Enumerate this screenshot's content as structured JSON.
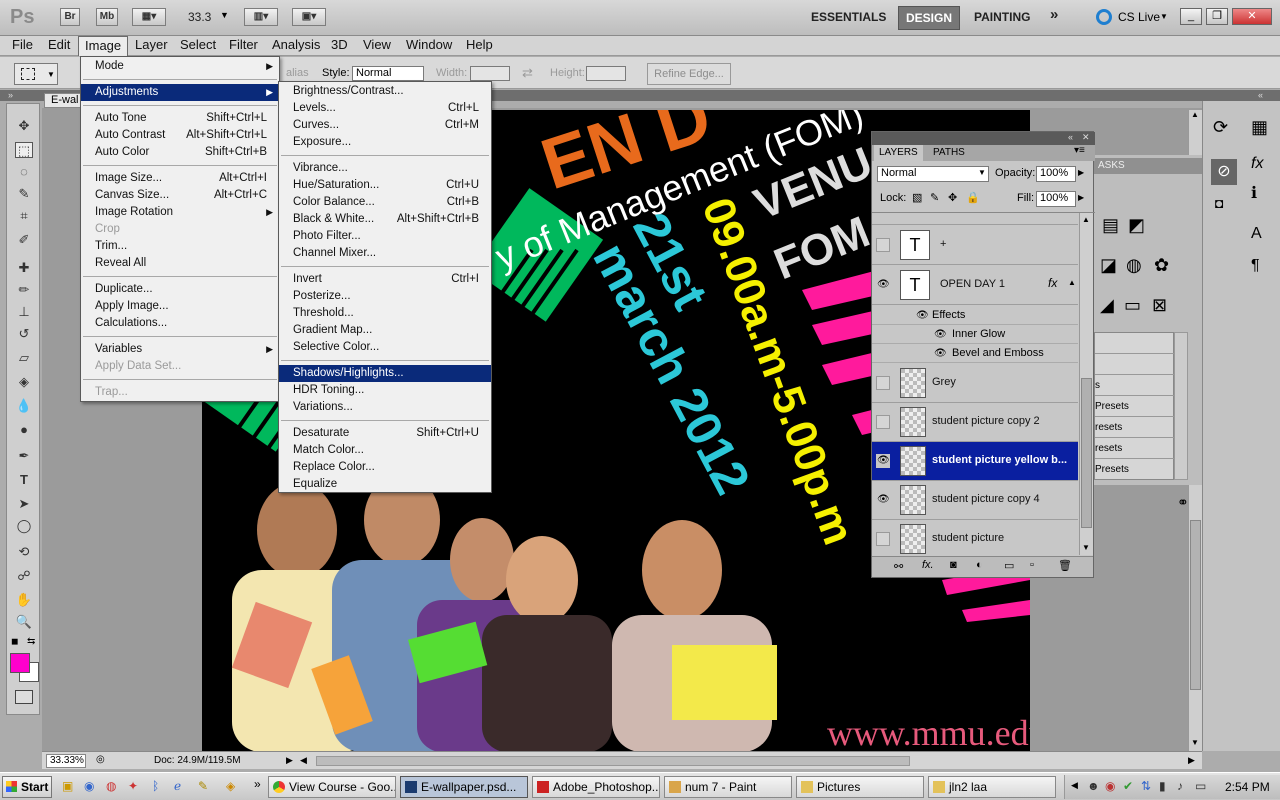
{
  "titlebar": {
    "app_logo": "Ps",
    "bridge_btn": "Br",
    "minibridge_btn": "Mb",
    "zoom_value": "33.3",
    "workspaces": [
      "ESSENTIALS",
      "DESIGN",
      "PAINTING"
    ],
    "more": "»",
    "cs_live": "CS Live",
    "window_controls": [
      "_",
      "❐",
      "✕"
    ]
  },
  "menubar": [
    "File",
    "Edit",
    "Image",
    "Layer",
    "Select",
    "Filter",
    "Analysis",
    "3D",
    "View",
    "Window",
    "Help"
  ],
  "optionsbar": {
    "antialias": "alias",
    "style_label": "Style:",
    "style_value": "Normal",
    "width_label": "Width:",
    "height_label": "Height:",
    "refine_edge": "Refine Edge..."
  },
  "document": {
    "tab_title": "E-wal",
    "status_zoom": "33.33%",
    "status_doc": "Doc: 24.9M/119.5M",
    "art": {
      "line1": "EN D",
      "line2": "y of Management (FOM)",
      "venue": "VENU",
      "fom": "FOM",
      "date": "21st",
      "month": "march 2012",
      "time": "09.00a.m-5.00p.m",
      "url": "www.mmu.edu"
    }
  },
  "image_menu": [
    {
      "label": "Mode",
      "shortcut": "",
      "submenu": true
    },
    {
      "sep": true
    },
    {
      "label": "Adjustments",
      "shortcut": "",
      "submenu": true,
      "highlight": true
    },
    {
      "sep": true
    },
    {
      "label": "Auto Tone",
      "shortcut": "Shift+Ctrl+L"
    },
    {
      "label": "Auto Contrast",
      "shortcut": "Alt+Shift+Ctrl+L"
    },
    {
      "label": "Auto Color",
      "shortcut": "Shift+Ctrl+B"
    },
    {
      "sep": true
    },
    {
      "label": "Image Size...",
      "shortcut": "Alt+Ctrl+I"
    },
    {
      "label": "Canvas Size...",
      "shortcut": "Alt+Ctrl+C"
    },
    {
      "label": "Image Rotation",
      "shortcut": "",
      "submenu": true
    },
    {
      "label": "Crop",
      "shortcut": "",
      "disabled": true
    },
    {
      "label": "Trim...",
      "shortcut": ""
    },
    {
      "label": "Reveal All",
      "shortcut": ""
    },
    {
      "sep": true
    },
    {
      "label": "Duplicate...",
      "shortcut": ""
    },
    {
      "label": "Apply Image...",
      "shortcut": ""
    },
    {
      "label": "Calculations...",
      "shortcut": ""
    },
    {
      "sep": true
    },
    {
      "label": "Variables",
      "shortcut": "",
      "submenu": true
    },
    {
      "label": "Apply Data Set...",
      "shortcut": "",
      "disabled": true
    },
    {
      "sep": true
    },
    {
      "label": "Trap...",
      "shortcut": "",
      "disabled": true
    }
  ],
  "adjustments_menu": [
    {
      "label": "Brightness/Contrast...",
      "shortcut": ""
    },
    {
      "label": "Levels...",
      "shortcut": "Ctrl+L"
    },
    {
      "label": "Curves...",
      "shortcut": "Ctrl+M"
    },
    {
      "label": "Exposure...",
      "shortcut": ""
    },
    {
      "sep": true
    },
    {
      "label": "Vibrance...",
      "shortcut": ""
    },
    {
      "label": "Hue/Saturation...",
      "shortcut": "Ctrl+U"
    },
    {
      "label": "Color Balance...",
      "shortcut": "Ctrl+B"
    },
    {
      "label": "Black & White...",
      "shortcut": "Alt+Shift+Ctrl+B"
    },
    {
      "label": "Photo Filter...",
      "shortcut": ""
    },
    {
      "label": "Channel Mixer...",
      "shortcut": ""
    },
    {
      "sep": true
    },
    {
      "label": "Invert",
      "shortcut": "Ctrl+I"
    },
    {
      "label": "Posterize...",
      "shortcut": ""
    },
    {
      "label": "Threshold...",
      "shortcut": ""
    },
    {
      "label": "Gradient Map...",
      "shortcut": ""
    },
    {
      "label": "Selective Color...",
      "shortcut": ""
    },
    {
      "sep": true
    },
    {
      "label": "Shadows/Highlights...",
      "shortcut": "",
      "highlight": true
    },
    {
      "label": "HDR Toning...",
      "shortcut": ""
    },
    {
      "label": "Variations...",
      "shortcut": ""
    },
    {
      "sep": true
    },
    {
      "label": "Desaturate",
      "shortcut": "Shift+Ctrl+U"
    },
    {
      "label": "Match Color...",
      "shortcut": ""
    },
    {
      "label": "Replace Color...",
      "shortcut": ""
    },
    {
      "label": "Equalize",
      "shortcut": ""
    }
  ],
  "layers_panel": {
    "tabs": [
      "LAYERS",
      "PATHS"
    ],
    "blend_mode": "Normal",
    "opacity_label": "Opacity:",
    "opacity_value": "100%",
    "lock_label": "Lock:",
    "fill_label": "Fill:",
    "fill_value": "100%",
    "layers": [
      {
        "name": "+",
        "type": "text",
        "visible": false
      },
      {
        "name": "OPEN DAY 1",
        "type": "text",
        "visible": true,
        "fx": "fx"
      },
      {
        "name": "Grey",
        "type": "pixel",
        "visible": false
      },
      {
        "name": "student picture copy 2",
        "type": "pixel",
        "visible": false
      },
      {
        "name": "student picture yellow b...",
        "type": "pixel",
        "visible": true,
        "selected": true
      },
      {
        "name": "student picture copy 4",
        "type": "pixel",
        "visible": true
      },
      {
        "name": "student picture",
        "type": "pixel",
        "visible": false
      }
    ],
    "effects": {
      "title": "Effects",
      "items": [
        "Inner Glow",
        "Bevel and Emboss"
      ]
    }
  },
  "side_dock": {
    "tab_label": "ASKS",
    "presets": [
      "s",
      "Presets",
      "resets",
      "resets",
      "Presets"
    ]
  },
  "taskbar": {
    "start": "Start",
    "tasks": [
      {
        "label": "View Course - Goo...",
        "active": false
      },
      {
        "label": "E-wallpaper.psd...",
        "active": true
      },
      {
        "label": "Adobe_Photoshop...",
        "active": false
      },
      {
        "label": "num 7 - Paint",
        "active": false
      },
      {
        "label": "Pictures",
        "active": false
      },
      {
        "label": "jln2 laa",
        "active": false
      }
    ],
    "clock": "2:54 PM"
  },
  "colors": {
    "foreground": "#ff00cc",
    "background": "#ffffff",
    "menu_highlight": "#0a2a7a",
    "layer_selected": "#0a1fa0"
  }
}
